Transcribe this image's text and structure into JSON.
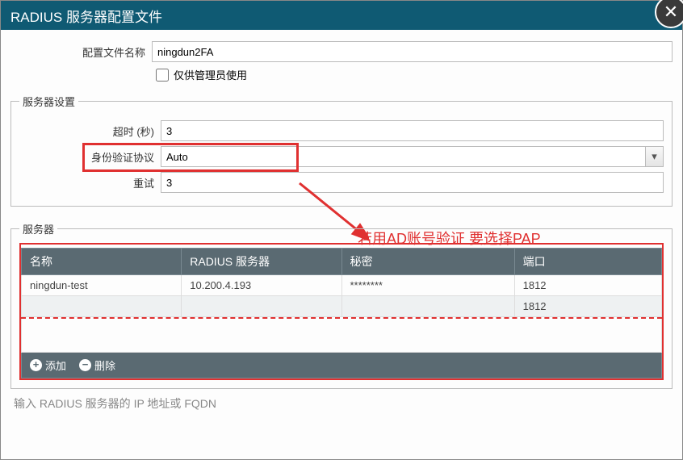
{
  "window": {
    "title": "RADIUS 服务器配置文件"
  },
  "profile": {
    "name_label": "配置文件名称",
    "name_value": "ningdun2FA",
    "admin_only_label": "仅供管理员使用"
  },
  "server_settings": {
    "legend": "服务器设置",
    "timeout_label": "超时 (秒)",
    "timeout_value": "3",
    "auth_proto_label": "身份验证协议",
    "auth_proto_value": "Auto",
    "retries_label": "重试",
    "retries_value": "3"
  },
  "annotation": {
    "text": "若用AD账号验证 要选择PAP"
  },
  "servers": {
    "legend": "服务器",
    "columns": {
      "name": "名称",
      "server": "RADIUS 服务器",
      "secret": "秘密",
      "port": "端口"
    },
    "rows": [
      {
        "name": "ningdun-test",
        "server": "10.200.4.193",
        "secret": "********",
        "port": "1812"
      },
      {
        "name": "",
        "server": "",
        "secret": "",
        "port": "1812"
      }
    ],
    "add_label": "添加",
    "delete_label": "删除"
  },
  "status_hint": "输入 RADIUS 服务器的 IP 地址或 FQDN"
}
